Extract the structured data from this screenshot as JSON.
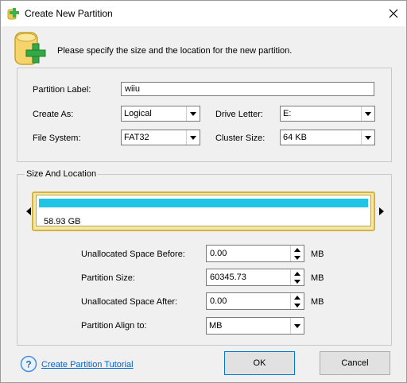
{
  "window": {
    "title": "Create New Partition",
    "header_text": "Please specify the size and the location for the new partition."
  },
  "form": {
    "partition_label_label": "Partition Label:",
    "partition_label_value": "wiiu",
    "create_as_label": "Create As:",
    "create_as_value": "Logical",
    "drive_letter_label": "Drive Letter:",
    "drive_letter_value": "E:",
    "file_system_label": "File System:",
    "file_system_value": "FAT32",
    "cluster_size_label": "Cluster Size:",
    "cluster_size_value": "64 KB"
  },
  "size_location": {
    "group_title": "Size And Location",
    "disk_size": "58.93 GB",
    "partition_fill_fraction": 1.0,
    "unallocated_before_label": "Unallocated Space Before:",
    "unallocated_before_value": "0.00",
    "partition_size_label": "Partition Size:",
    "partition_size_value": "60345.73",
    "unallocated_after_label": "Unallocated Space After:",
    "unallocated_after_value": "0.00",
    "align_label": "Partition Align to:",
    "align_value": "MB",
    "unit": "MB"
  },
  "footer": {
    "tutorial_link": "Create Partition Tutorial",
    "ok_label": "OK",
    "cancel_label": "Cancel"
  },
  "colors": {
    "partition_bar": "#20c4e4",
    "disk_frame": "#d3b43f",
    "link": "#0066cc"
  }
}
